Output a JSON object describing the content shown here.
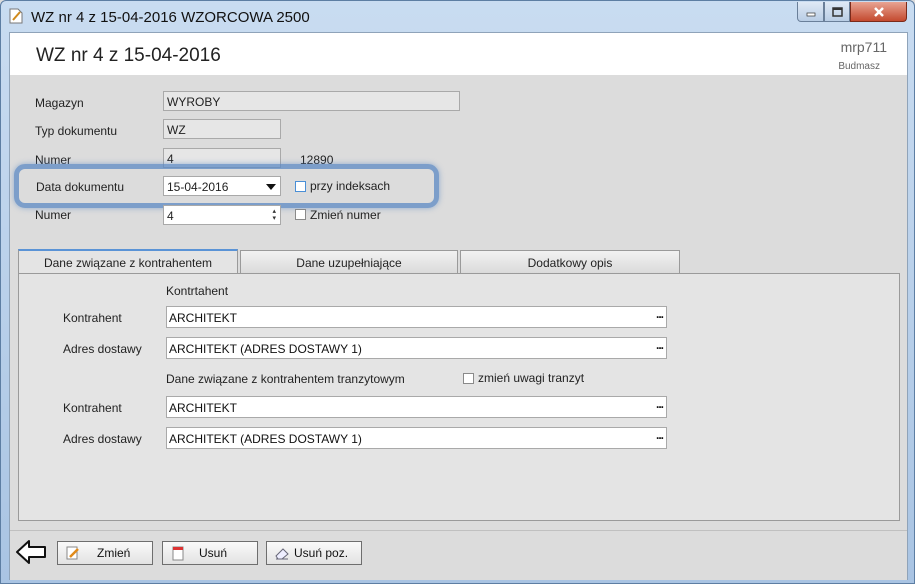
{
  "window": {
    "title": "WZ nr 4 z 15-04-2016 WZORCOWA 2500",
    "minimize_icon": "minimize-icon",
    "maximize_icon": "maximize-icon",
    "close_icon": "close-icon"
  },
  "header": {
    "doc_title": "WZ nr 4 z 15-04-2016",
    "app_code": "mrp711",
    "company": "Budmasz"
  },
  "form": {
    "magazyn_label": "Magazyn",
    "magazyn_value": "WYROBY",
    "typ_label": "Typ dokumentu",
    "typ_value": "WZ",
    "numer_label": "Numer",
    "numer_value": "4",
    "numer_extra": "12890",
    "data_label": "Data dokumentu",
    "data_value": "15-04-2016",
    "przy_indeksach_label": "przy indeksach",
    "numer2_label": "Numer",
    "numer2_value": "4",
    "zmien_numer_label": "Zmień numer"
  },
  "tabs": [
    {
      "label": "Dane związane z kontrahentem",
      "active": true
    },
    {
      "label": "Dane uzupełniające",
      "active": false
    },
    {
      "label": "Dodatkowy opis",
      "active": false
    }
  ],
  "contractor": {
    "section_title": "Kontrtahent",
    "kontrahent_label": "Kontrahent",
    "kontrahent_value": "ARCHITEKT",
    "adres_label": "Adres dostawy",
    "adres_value": "ARCHITEKT (ADRES DOSTAWY 1)",
    "transit_title": "Dane związane z kontrahentem tranzytowym",
    "zmien_uwagi_label": "zmień uwagi tranzyt",
    "t_kontrahent_label": "Kontrahent",
    "t_kontrahent_value": "ARCHITEKT",
    "t_adres_label": "Adres dostawy",
    "t_adres_value": "ARCHITEKT (ADRES DOSTAWY 1)",
    "lookup_label": "..."
  },
  "toolbar": {
    "back_icon": "back-arrow-icon",
    "zmien_label": "Zmień",
    "usun_label": "Usuń",
    "usun_poz_label": "Usuń poz."
  },
  "colors": {
    "highlight": "#5c8ac4",
    "title_bar": "#b9d1ea",
    "close_button": "#c44a2f"
  }
}
